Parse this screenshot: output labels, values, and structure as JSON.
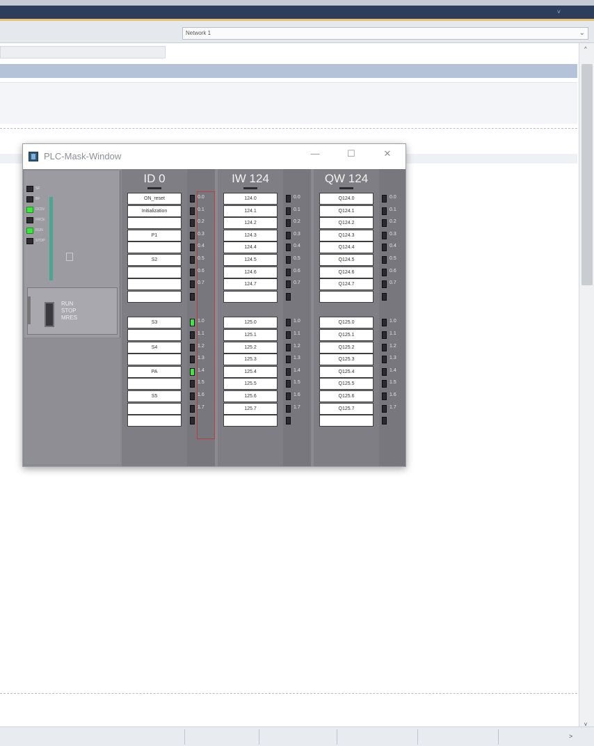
{
  "window": {
    "system_button": "˅"
  },
  "toolbar": {
    "dropdown_value": "Network 1",
    "dropdown_chevron": "⌄"
  },
  "scroll": {
    "up_arrow": "^",
    "down_arrow": "v",
    "right_arrow": ">"
  },
  "plc_window": {
    "title": "PLC-Mask-Window",
    "minimize": "—",
    "maximize": "☐",
    "close": "✕",
    "cpu": {
      "leds": [
        {
          "label": "SF",
          "on": false
        },
        {
          "label": "BF",
          "on": false
        },
        {
          "label": "DC5V",
          "on": true
        },
        {
          "label": "FRCE",
          "on": false
        },
        {
          "label": "RUN",
          "on": true
        },
        {
          "label": "STOP",
          "on": false
        }
      ],
      "mode_labels": [
        "RUN",
        "STOP",
        "MRES"
      ]
    },
    "input_module": {
      "header": "ID 0",
      "cells": [
        "ON_reset",
        "Initialization",
        "",
        "P1",
        "",
        "S2",
        "",
        "",
        "",
        "S3",
        "",
        "S4",
        "",
        "PA",
        "",
        "S5",
        "",
        ""
      ],
      "bits": [
        "0.0",
        "0.1",
        "0.2",
        "0.3",
        "0.4",
        "0.5",
        "0.6",
        "0.7",
        "",
        "1.0",
        "1.1",
        "1.2",
        "1.3",
        "1.4",
        "1.5",
        "1.6",
        "1.7",
        ""
      ],
      "leds_on": [
        false,
        false,
        false,
        false,
        false,
        false,
        false,
        false,
        false,
        true,
        false,
        false,
        false,
        true,
        false,
        false,
        false,
        false
      ]
    },
    "iw_module": {
      "header": "IW 124",
      "cells": [
        "124.0",
        "124.1",
        "124.2",
        "124.3",
        "124.4",
        "124.5",
        "124.6",
        "124.7",
        "",
        "125.0",
        "125.1",
        "125.2",
        "125.3",
        "125.4",
        "125.5",
        "125.6",
        "125.7",
        ""
      ],
      "bits": [
        "0.0",
        "0.1",
        "0.2",
        "0.3",
        "0.4",
        "0.5",
        "0.6",
        "0.7",
        "",
        "1.0",
        "1.1",
        "1.2",
        "1.3",
        "1.4",
        "1.5",
        "1.6",
        "1.7",
        ""
      ]
    },
    "qw_module": {
      "header": "QW 124",
      "cells": [
        "Q124.0",
        "Q124.1",
        "Q124.2",
        "Q124.3",
        "Q124.4",
        "Q124.5",
        "Q124.6",
        "Q124.7",
        "",
        "Q125.0",
        "Q125.1",
        "Q125.2",
        "Q125.3",
        "Q125.4",
        "Q125.5",
        "Q125.6",
        "Q125.7",
        ""
      ],
      "bits": [
        "0.0",
        "0.1",
        "0.2",
        "0.3",
        "0.4",
        "0.5",
        "0.6",
        "0.7",
        "",
        "1.0",
        "1.1",
        "1.2",
        "1.3",
        "1.4",
        "1.5",
        "1.6",
        "1.7",
        ""
      ]
    }
  }
}
